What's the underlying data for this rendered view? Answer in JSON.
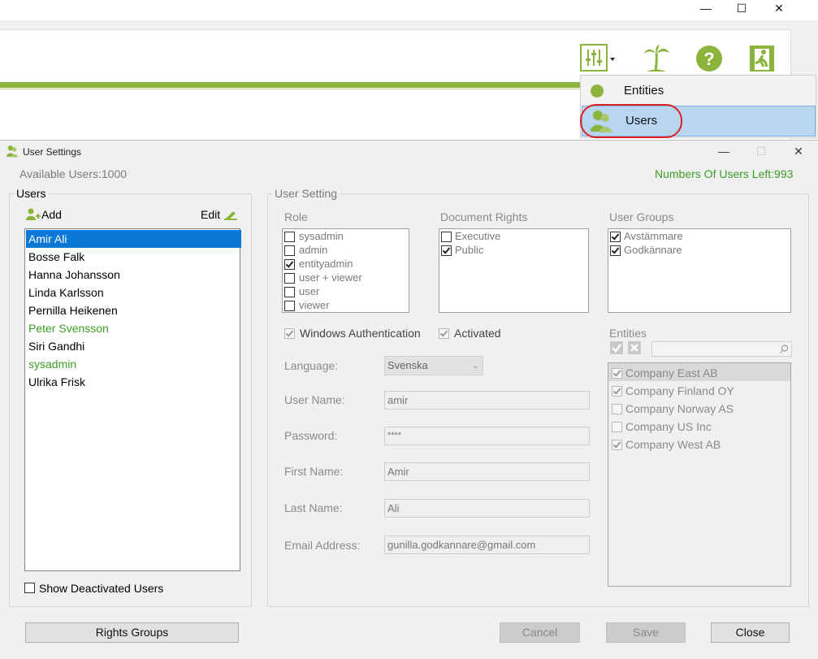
{
  "main_window": {
    "controls": {
      "minimize": "—",
      "maximize": "☐",
      "close": "✕"
    },
    "toolbar_icons": [
      "settings-sliders-icon",
      "palm-tree-icon",
      "help-icon",
      "exit-icon"
    ]
  },
  "menu": {
    "items": [
      {
        "label": "Entities",
        "icon": "green-dot-icon"
      },
      {
        "label": "Users",
        "icon": "users-icon"
      }
    ]
  },
  "dialog": {
    "title": "User Settings",
    "controls": {
      "minimize": "—",
      "maximize": "☐",
      "close": "✕"
    },
    "available_users": "Available Users:1000",
    "users_left": "Numbers Of Users Left:993",
    "users_group": {
      "legend": "Users",
      "add_label": "Add",
      "edit_label": "Edit",
      "list": [
        {
          "name": "Amir Ali",
          "state": "selected"
        },
        {
          "name": "Bosse Falk",
          "state": "normal"
        },
        {
          "name": "Hanna Johansson",
          "state": "normal"
        },
        {
          "name": "Linda Karlsson",
          "state": "normal"
        },
        {
          "name": "Pernilla Heikenen",
          "state": "normal"
        },
        {
          "name": "Peter Svensson",
          "state": "green"
        },
        {
          "name": "Siri Gandhi",
          "state": "normal"
        },
        {
          "name": "sysadmin",
          "state": "green"
        },
        {
          "name": "Ulrika Frisk",
          "state": "normal"
        }
      ],
      "show_deactivated_label": "Show Deactivated Users",
      "show_deactivated_checked": false
    },
    "user_setting": {
      "legend": "User Setting",
      "role": {
        "label": "Role",
        "items": [
          {
            "label": "sysadmin",
            "checked": false
          },
          {
            "label": "admin",
            "checked": false
          },
          {
            "label": "entityadmin",
            "checked": true
          },
          {
            "label": "user + viewer",
            "checked": false
          },
          {
            "label": "user",
            "checked": false
          },
          {
            "label": "viewer",
            "checked": false
          }
        ]
      },
      "document_rights": {
        "label": "Document Rights",
        "items": [
          {
            "label": "Executive",
            "checked": false
          },
          {
            "label": "Public",
            "checked": true
          }
        ]
      },
      "user_groups": {
        "label": "User Groups",
        "items": [
          {
            "label": "Avstämmare",
            "checked": true
          },
          {
            "label": "Godkännare",
            "checked": true
          }
        ]
      },
      "windows_auth": {
        "label": "Windows Authentication",
        "checked": true
      },
      "activated": {
        "label": "Activated",
        "checked": true
      },
      "language": {
        "label": "Language:",
        "value": "Svenska"
      },
      "user_name": {
        "label": "User Name:",
        "value": "amir"
      },
      "password": {
        "label": "Password:",
        "value": "****"
      },
      "first_name": {
        "label": "First Name:",
        "value": "Amir"
      },
      "last_name": {
        "label": "Last Name:",
        "value": "Ali"
      },
      "email": {
        "label": "Email Address:",
        "value": "gunilla.godkannare@gmail.com"
      },
      "entities": {
        "label": "Entities",
        "search_value": "",
        "items": [
          {
            "label": "Company East AB",
            "checked": true
          },
          {
            "label": "Company Finland OY",
            "checked": true
          },
          {
            "label": "Company Norway AS",
            "checked": false
          },
          {
            "label": "Company US Inc",
            "checked": false
          },
          {
            "label": "Company West AB",
            "checked": true
          }
        ]
      }
    },
    "buttons": {
      "rights_groups": "Rights Groups",
      "cancel": "Cancel",
      "save": "Save",
      "close": "Close"
    },
    "colors": {
      "accent_green": "#8cb33c",
      "selection_blue": "#0a78d7",
      "status_green": "#3a9d23"
    }
  }
}
